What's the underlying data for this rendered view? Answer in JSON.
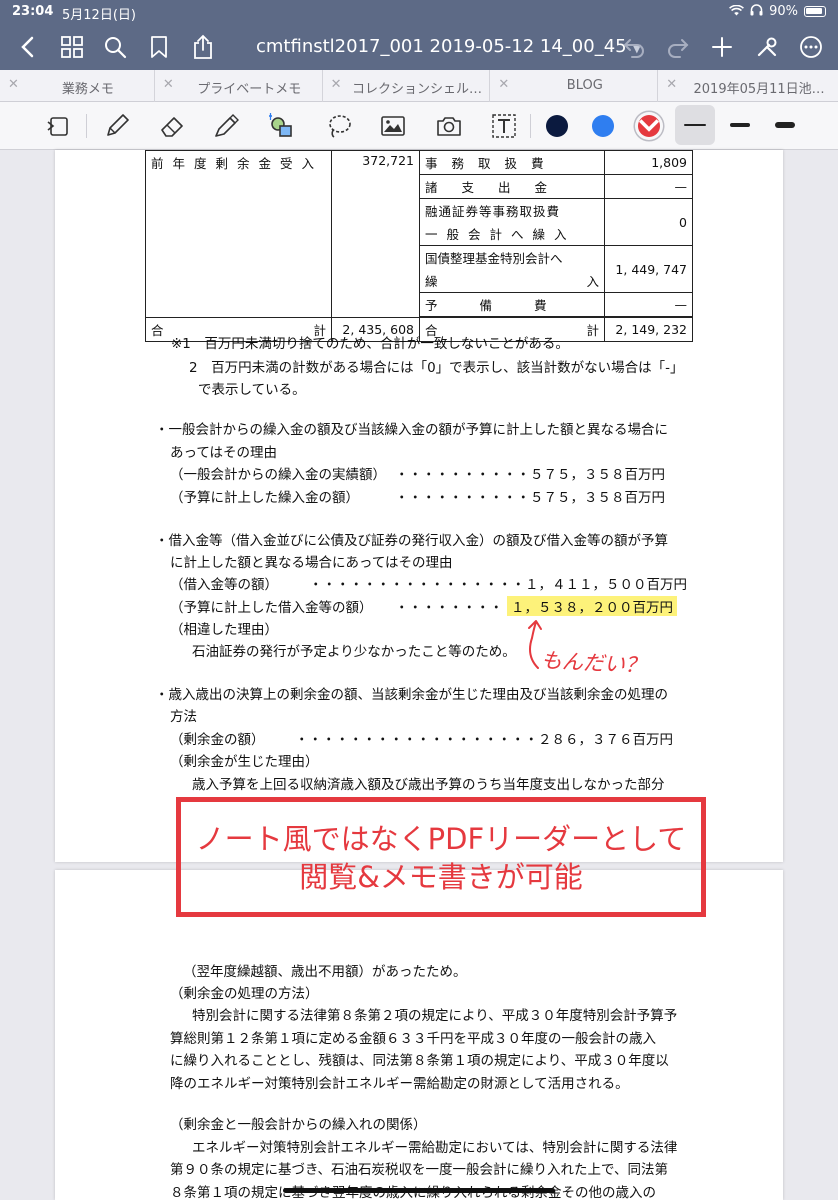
{
  "status_bar": {
    "time": "23:04",
    "date": "5月12日(日)",
    "battery": "90%"
  },
  "title_bar": {
    "document_title": "cmtfinstl2017_001 2019-05-12 14_00_45"
  },
  "tabs": [
    {
      "label": "業務メモ"
    },
    {
      "label": "プライベートメモ"
    },
    {
      "label": "コレクションシェル…"
    },
    {
      "label": "BLOG"
    },
    {
      "label": "2019年05月11日池…"
    }
  ],
  "colors": {
    "topbar": "#5d6a86",
    "annotation_red": "#e5393f",
    "highlight": "#fdf27a",
    "pen_navy": "#0b1a3f",
    "pen_blue": "#2f7ef0",
    "pen_red": "#e5393f"
  },
  "table": {
    "left_label": "前年度剰余金受入",
    "left_value": "372,721",
    "right_rows": [
      {
        "label": "事務取扱費",
        "value": "1,809"
      },
      {
        "label": "諸支出金",
        "value": "—"
      },
      {
        "label_line1": "融通証券等事務取扱費",
        "label_line2": "一般会計へ繰入",
        "value": "0"
      },
      {
        "label_line1": "国債整理基金特別会計へ",
        "label_line2a": "繰",
        "label_line2b": "入",
        "value": "1, 449, 747"
      },
      {
        "label": "予備費",
        "value": "—"
      }
    ],
    "total_label_left": "合",
    "total_label_right": "計",
    "total_left_value": "2, 435, 608",
    "total_right_value": "2, 149, 232"
  },
  "notes": {
    "note1": "※1　百万円未満切り捨てのため、合計が一致しないことがある。",
    "note2a": "2　百万円未満の計数がある場合には「0」で表示し、該当計数がない場合は「-」",
    "note2b": "で表示している。"
  },
  "section1": {
    "line1": "・一般会計からの繰入金の額及び当該繰入金の額が予算に計上した額と異なる場合に",
    "line2": "あってはその理由",
    "row1_label": "（一般会計からの繰入金の実績額）",
    "row1_value": "・・・・・・・・・・５７５，３５８百万円",
    "row2_label": "（予算に計上した繰入金の額）",
    "row2_value": "・・・・・・・・・・５７５，３５８百万円"
  },
  "section2": {
    "line1": "・借入金等（借入金並びに公債及び証券の発行収入金）の額及び借入金等の額が予算",
    "line2": "に計上した額と異なる場合にあってはその理由",
    "row1_label": "（借入金等の額）",
    "row1_value": "・・・・・・・・・・・・・・・・１，４１１，５００百万円",
    "row2_label": "（予算に計上した借入金等の額）",
    "row2_dots": "・・・・・・・・",
    "row2_value": "１，５３８，２００百万円",
    "reason_label": "（相違した理由）",
    "reason_text": "石油証券の発行が予定より少なかったこと等のため。"
  },
  "section3": {
    "line1": "・歳入歳出の決算上の剰余金の額、当該剰余金が生じた理由及び当該剰余金の処理の",
    "line2": "方法",
    "row1_label": "（剰余金の額）",
    "row1_value": "・・・・・・・・・・・・・・・・・・２８６，３７６百万円",
    "reason_label": "（剰余金が生じた理由）",
    "reason_text": "歳入予算を上回る収納済歳入額及び歳出予算のうち当年度支出しなかった部分"
  },
  "annotations": {
    "handwritten": "もんだい？",
    "box_line1": "ノート風ではなくPDFリーダーとして",
    "box_line2": "閲覧&メモ書きが可能"
  },
  "page2": {
    "l1": "（翌年度繰越額、歳出不用額）があったため。",
    "l2": "（剰余金の処理の方法）",
    "l3": "特別会計に関する法律第８条第２項の規定により、平成３０年度特別会計予算予",
    "l4": "算総則第１２条第１項に定める金額６３３千円を平成３０年度の一般会計の歳入",
    "l5": "に繰り入れることとし、残額は、同法第８条第１項の規定により、平成３０年度以",
    "l6": "降のエネルギー対策特別会計エネルギー需給勘定の財源として活用される。",
    "l7": "（剰余金と一般会計からの繰入れの関係）",
    "l8": "エネルギー対策特別会計エネルギー需給勘定においては、特別会計に関する法律",
    "l9": "第９０条の規定に基づき、石油石炭税収を一度一般会計に繰り入れた上で、同法第",
    "l10": "８条第１項の規定に基づき翌年度の歳入に繰り入れられる剰余金その他の歳入の"
  }
}
